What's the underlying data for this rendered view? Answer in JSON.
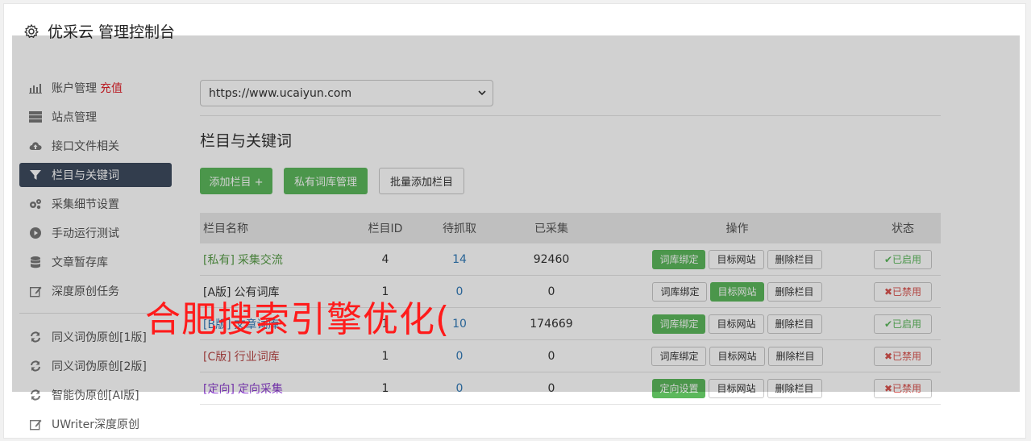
{
  "header": {
    "title": "优采云 管理控制台"
  },
  "sidebar": {
    "items": [
      {
        "label": "账户管理",
        "accent": "充值",
        "icon": "bar-chart-icon"
      },
      {
        "label": "站点管理",
        "icon": "server-icon"
      },
      {
        "label": "接口文件相关",
        "icon": "cloud-upload-icon"
      },
      {
        "label": "栏目与关键词",
        "icon": "filter-icon",
        "active": true
      },
      {
        "label": "采集细节设置",
        "icon": "cogs-icon"
      },
      {
        "label": "手动运行测试",
        "icon": "play-circle-icon"
      },
      {
        "label": "文章暂存库",
        "icon": "database-icon"
      },
      {
        "label": "深度原创任务",
        "icon": "edit-icon"
      }
    ],
    "items2": [
      {
        "label": "同义词伪原创[1版]",
        "icon": "refresh-icon"
      },
      {
        "label": "同义词伪原创[2版]",
        "icon": "refresh-icon"
      },
      {
        "label": "智能伪原创[AI版]",
        "icon": "refresh-icon"
      },
      {
        "label": "UWriter深度原创",
        "icon": "edit-icon"
      }
    ]
  },
  "site_select": {
    "value": "https://www.ucaiyun.com"
  },
  "section_title": "栏目与关键词",
  "toolbar": {
    "add_label": "添加栏目 +",
    "private_label": "私有词库管理",
    "batch_label": "批量添加栏目"
  },
  "table": {
    "headers": {
      "name": "栏目名称",
      "id": "栏目ID",
      "wait": "待抓取",
      "collected": "已采集",
      "ops": "操作",
      "status": "状态"
    },
    "rows": [
      {
        "tag": "[私有]",
        "name": "采集交流",
        "name_color": "#5a9e4a",
        "id": "4",
        "wait": "14",
        "collected": "92460",
        "ops": [
          "词库绑定",
          "目标网站",
          "删除栏目"
        ],
        "ops_green": [
          0
        ],
        "status": "✔已启用",
        "status_on": true
      },
      {
        "tag": "[A版]",
        "name": "公有词库",
        "name_color": "#333333",
        "id": "1",
        "wait": "0",
        "collected": "0",
        "ops": [
          "词库绑定",
          "目标网站",
          "删除栏目"
        ],
        "ops_green": [
          1
        ],
        "status": "✖已禁用",
        "status_on": false
      },
      {
        "tag": "[B版]",
        "name": "文章词库",
        "name_color": "#337ab7",
        "id": "1",
        "wait": "10",
        "collected": "174669",
        "ops": [
          "词库绑定",
          "目标网站",
          "删除栏目"
        ],
        "ops_green": [
          0
        ],
        "status": "✔已启用",
        "status_on": true
      },
      {
        "tag": "[C版]",
        "name": "行业词库",
        "name_color": "#b94a48",
        "id": "1",
        "wait": "0",
        "collected": "0",
        "ops": [
          "词库绑定",
          "目标网站",
          "删除栏目"
        ],
        "ops_green": [],
        "status": "✖已禁用",
        "status_on": false
      },
      {
        "tag": "[定向]",
        "name": "定向采集",
        "name_color": "#8a3ccc",
        "id": "1",
        "wait": "0",
        "collected": "0",
        "ops": [
          "定向设置",
          "目标网站",
          "删除栏目"
        ],
        "ops_green": [
          0
        ],
        "status": "✖已禁用",
        "status_on": false
      }
    ]
  },
  "watermark": "合肥搜索引擎优化("
}
